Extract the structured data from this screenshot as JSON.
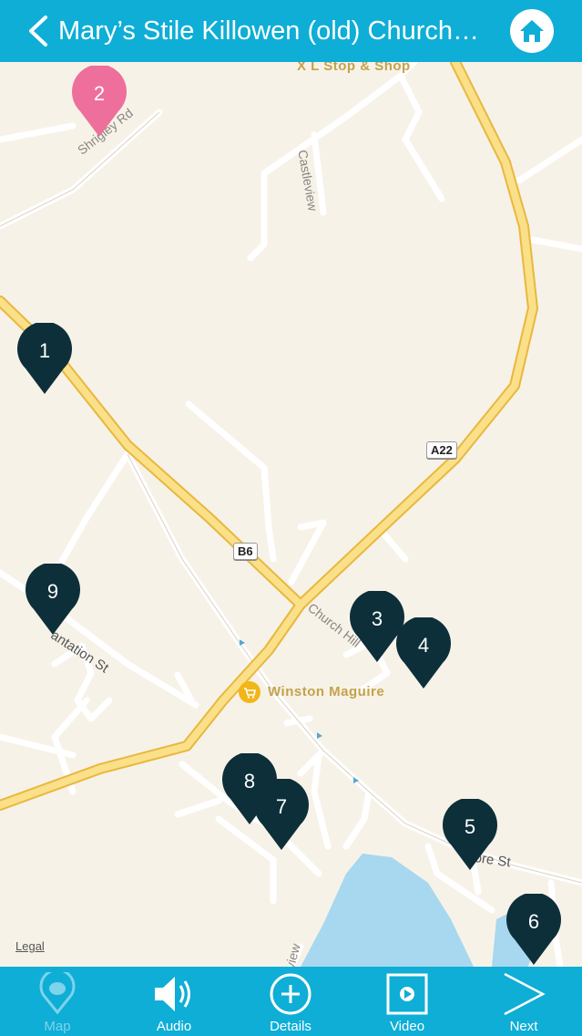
{
  "header": {
    "title": "Mary’s Stile Killowen (old) Church…"
  },
  "map": {
    "poi": {
      "shop": "X L Stop & Shop",
      "winston": "Winston Maguire"
    },
    "streets": {
      "shrigley": "Shrigley Rd",
      "castleview": "Castleview",
      "church": "Church Hill",
      "plantation": "antation St",
      "shore": "ore St",
      "view": "view"
    },
    "shields": {
      "a22": "A22",
      "b6": "B6"
    },
    "legal": "Legal",
    "pins": [
      {
        "label": "1",
        "color": "#0d2f3a"
      },
      {
        "label": "2",
        "color": "#ee6f9b"
      },
      {
        "label": "3",
        "color": "#0d2f3a"
      },
      {
        "label": "4",
        "color": "#0d2f3a"
      },
      {
        "label": "5",
        "color": "#0d2f3a"
      },
      {
        "label": "6",
        "color": "#0d2f3a"
      },
      {
        "label": "7",
        "color": "#0d2f3a"
      },
      {
        "label": "8",
        "color": "#0d2f3a"
      },
      {
        "label": "9",
        "color": "#0d2f3a"
      }
    ]
  },
  "tabs": [
    {
      "label": "Map",
      "icon": "map-pin-icon"
    },
    {
      "label": "Audio",
      "icon": "speaker-icon"
    },
    {
      "label": "Details",
      "icon": "plus-circle-icon"
    },
    {
      "label": "Video",
      "icon": "video-play-icon"
    },
    {
      "label": "Next",
      "icon": "chevron-right-icon"
    }
  ],
  "colors": {
    "accent": "#0eaed6",
    "pin_dark": "#0d2f3a",
    "pin_pink": "#ee6f9b",
    "water": "#a7d8ef",
    "major_road": "#f5c24a"
  }
}
